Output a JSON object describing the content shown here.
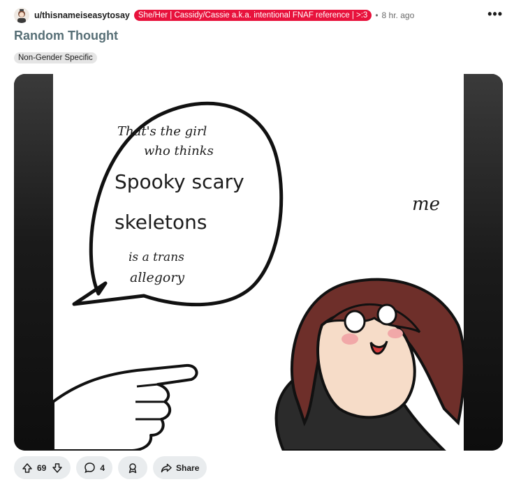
{
  "post": {
    "username": "u/thisnameiseasytosay",
    "flair": "She/Her | Cassidy/Cassie a.k.a. intentional FNAF reference | >:3",
    "separator": "•",
    "time": "8 hr. ago",
    "title": "Random Thought",
    "tag": "Non-Gender Specific"
  },
  "image": {
    "speech_line1": "That's the girl",
    "speech_line2": "who thinks",
    "speech_line3": "Spooky scary",
    "speech_line4": "skeletons",
    "speech_line5": "is a trans",
    "speech_line6": "allegory",
    "me_label": "me"
  },
  "actions": {
    "upvotes": "69",
    "comments": "4",
    "share_label": "Share"
  },
  "icons": {
    "avatar": "avatar-icon",
    "more": "more-options-icon",
    "upvote": "upvote-arrow-icon",
    "downvote": "downvote-arrow-icon",
    "comment": "comment-bubble-icon",
    "award": "award-icon",
    "share": "share-arrow-icon"
  },
  "colors": {
    "flair_bg": "#e8123c",
    "title": "#576f76",
    "pill_bg": "#e9ecee"
  }
}
